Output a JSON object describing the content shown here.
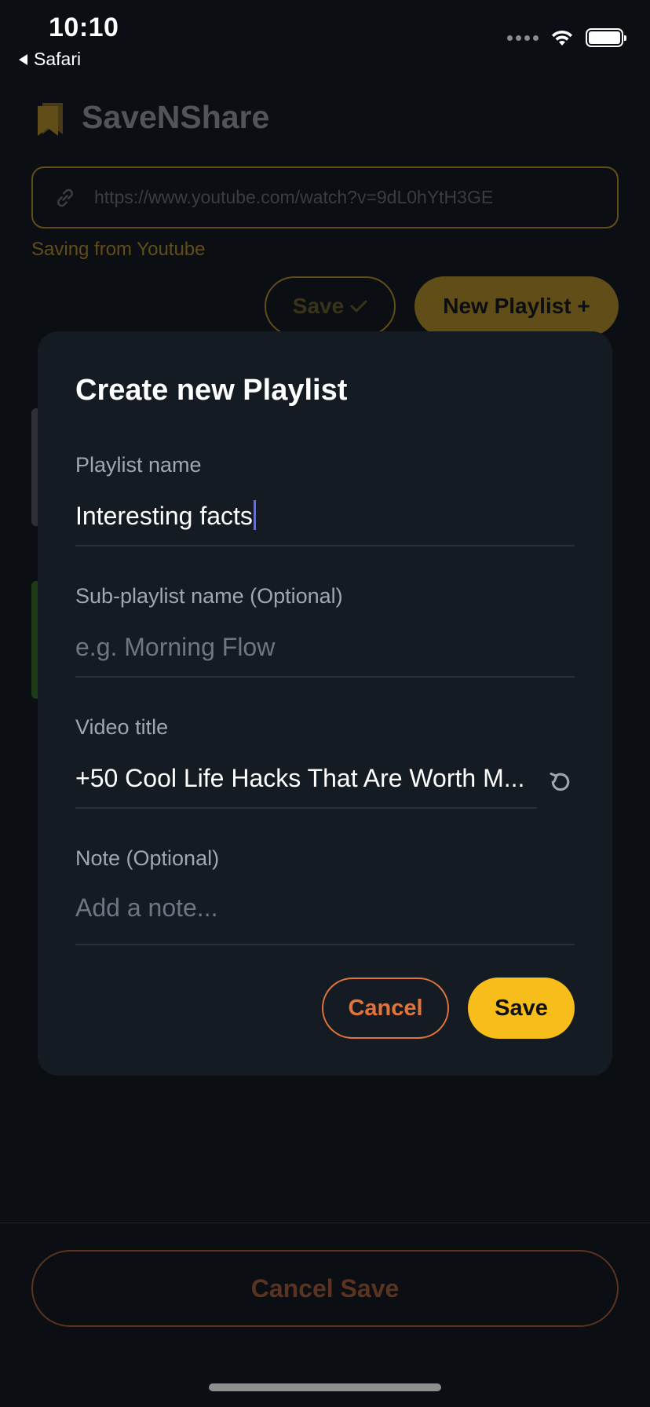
{
  "status_bar": {
    "time": "10:10",
    "back_app": "Safari"
  },
  "header": {
    "app_title": "SaveNShare"
  },
  "url_input": {
    "value": "https://www.youtube.com/watch?v=9dL0hYtH3GE"
  },
  "source_text": "Saving from Youtube",
  "actions": {
    "save_label": "Save",
    "new_playlist_label": "New Playlist +"
  },
  "modal": {
    "title": "Create new Playlist",
    "playlist_name": {
      "label": "Playlist name",
      "value": "Interesting facts"
    },
    "sub_playlist": {
      "label": "Sub-playlist name (Optional)",
      "placeholder": "e.g. Morning Flow"
    },
    "video_title": {
      "label": "Video title",
      "value": "+50 Cool Life Hacks That Are Worth M..."
    },
    "note": {
      "label": "Note (Optional)",
      "placeholder": "Add a note..."
    },
    "cancel_label": "Cancel",
    "save_label": "Save"
  },
  "footer": {
    "cancel_save_label": "Cancel Save"
  },
  "colors": {
    "accent": "#f7bd1a",
    "danger": "#e2743b",
    "modal_bg": "#151b22",
    "caret": "#5a6cff"
  }
}
